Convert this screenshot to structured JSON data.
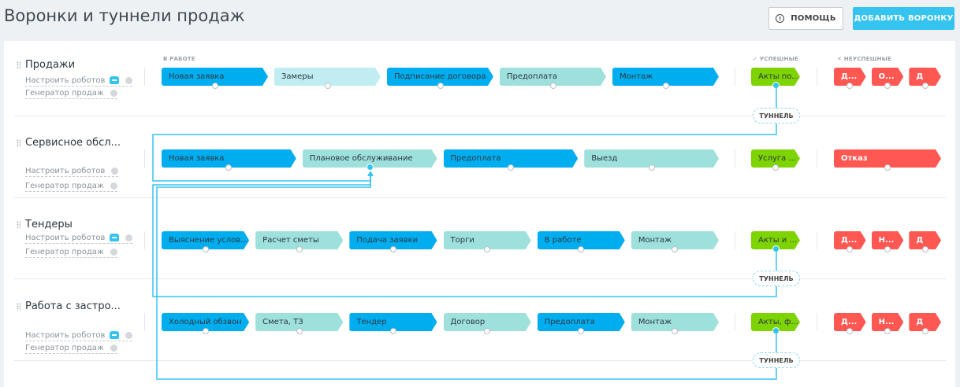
{
  "header": {
    "title": "Воронки и туннели продаж",
    "help_label": "ПОМОЩЬ",
    "add_label": "ДОБАВИТЬ ВОРОНКУ"
  },
  "columns": {
    "in_work": "В РАБОТЕ",
    "success": "✓ УСПЕШНЫЕ",
    "fail": "✕ НЕУСПЕШНЫЕ"
  },
  "links": {
    "robots": "Настроить роботов",
    "generator": "Генератор продаж"
  },
  "tunnel_label": "ТУННЕЛЬ",
  "colors": {
    "blue": "#00aeef",
    "cyan": "#bfedf2",
    "teal": "#9de0dc",
    "green": "#7ed400",
    "red": "#ff5752"
  },
  "funnels": [
    {
      "name": "Продажи",
      "robot_icon": true,
      "stages": [
        {
          "label": "Новая заявка",
          "color": "blue"
        },
        {
          "label": "Замеры",
          "color": "cyan"
        },
        {
          "label": "Подписание договора",
          "color": "blue"
        },
        {
          "label": "Предоплата",
          "color": "teal"
        },
        {
          "label": "Монтаж",
          "color": "blue"
        }
      ],
      "success": [
        {
          "label": "Акты по...",
          "tunnel": true
        }
      ],
      "fail": [
        {
          "label": "Д..."
        },
        {
          "label": "О..."
        },
        {
          "label": "Д"
        }
      ]
    },
    {
      "name": "Сервисное обсл...",
      "robot_icon": false,
      "stages": [
        {
          "label": "Новая заявка",
          "color": "blue"
        },
        {
          "label": "Плановое обслуживание",
          "color": "teal",
          "target": true
        },
        {
          "label": "Предоплата",
          "color": "blue"
        },
        {
          "label": "Выезд",
          "color": "teal"
        }
      ],
      "success": [
        {
          "label": "Услуга ..."
        }
      ],
      "fail": [
        {
          "label": "Отказ"
        }
      ]
    },
    {
      "name": "Тендеры",
      "robot_icon": true,
      "stages": [
        {
          "label": "Выяснение услов...",
          "color": "blue"
        },
        {
          "label": "Расчет сметы",
          "color": "teal"
        },
        {
          "label": "Подача заявки",
          "color": "blue"
        },
        {
          "label": "Торги",
          "color": "teal"
        },
        {
          "label": "В работе",
          "color": "blue"
        },
        {
          "label": "Монтаж",
          "color": "teal"
        }
      ],
      "success": [
        {
          "label": "Акты и ...",
          "tunnel": true
        }
      ],
      "fail": [
        {
          "label": "Д..."
        },
        {
          "label": "Н..."
        },
        {
          "label": "Д"
        }
      ]
    },
    {
      "name": "Работа с застро...",
      "robot_icon": true,
      "stages": [
        {
          "label": "Холодный обзвон",
          "color": "blue"
        },
        {
          "label": "Смета, ТЗ",
          "color": "teal"
        },
        {
          "label": "Тендер",
          "color": "blue"
        },
        {
          "label": "Договор",
          "color": "teal"
        },
        {
          "label": "Предоплата",
          "color": "blue"
        },
        {
          "label": "Монтаж",
          "color": "teal"
        }
      ],
      "success": [
        {
          "label": "Акты, ф...",
          "tunnel": true
        }
      ],
      "fail": [
        {
          "label": "Д..."
        },
        {
          "label": "Н..."
        },
        {
          "label": "Д"
        }
      ]
    }
  ]
}
